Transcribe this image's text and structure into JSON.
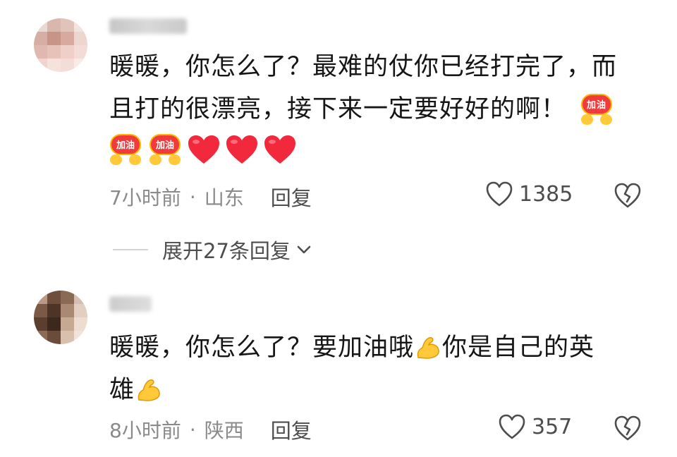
{
  "comments": [
    {
      "username": "",
      "text_line1": "暖暖，你怎么了？最难的仗你已经打完了，而",
      "text_line2": "且打的很漂亮，接下来一定要好好的啊！",
      "sticker_text": "加油",
      "emojis": [
        "jiayou-sticker",
        "jiayou-sticker",
        "red-heart",
        "red-heart",
        "red-heart"
      ],
      "time": "7小时前",
      "location": "山东",
      "reply_label": "回复",
      "like_count": "1385",
      "expand_label": "展开27条回复"
    },
    {
      "username": "",
      "text_part1": "暖暖，你怎么了？要加油哦",
      "text_part2": "你是自己的英",
      "text_line2": "雄",
      "emojis": [
        "flexed-biceps",
        "flexed-biceps"
      ],
      "time": "8小时前",
      "location": "陕西",
      "reply_label": "回复",
      "like_count": "357"
    }
  ],
  "colors": {
    "text": "#161616",
    "meta": "#8a8a8a",
    "action": "#4d4d4d",
    "heart": "#f2283c",
    "sticker": "#ef3b3b",
    "muscle": "#ffc93a"
  },
  "separator": "·"
}
